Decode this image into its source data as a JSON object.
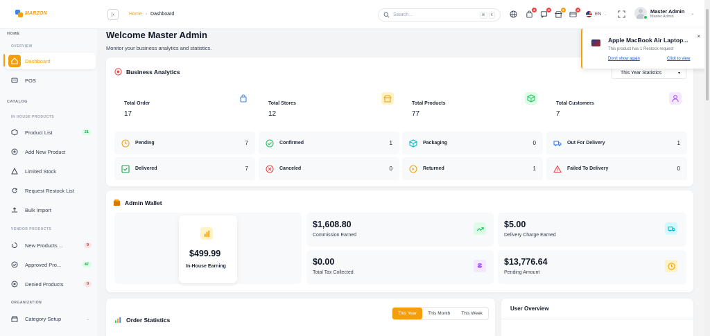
{
  "brand": {
    "name": "MARZON",
    "accent": "#f59e0b"
  },
  "header": {
    "collapse_icon": "collapse-sidebar-icon",
    "breadcrumb": {
      "home": "Home",
      "separator": "›",
      "current": "Dashboard"
    },
    "search": {
      "placeholder": "Search...",
      "shortcut_cmd": "⌘",
      "shortcut_key": "K"
    },
    "badges": {
      "orders": "4",
      "messages": "4",
      "stores": "0",
      "payments": "4",
      "wallet": "4"
    },
    "language": "EN",
    "user": {
      "name": "Master Admin",
      "role": "Master Admin"
    }
  },
  "sidebar": {
    "home_heading": "HOME",
    "overview_heading": "OVERVIEW",
    "overview_items": [
      {
        "label": "Dashboard",
        "icon": "dashboard-icon"
      },
      {
        "label": "POS",
        "icon": "pos-icon"
      }
    ],
    "catalog_heading": "CATALOG",
    "inhouse_heading": "IN HOUSE PRODUCTS",
    "inhouse_items": [
      {
        "label": "Product List",
        "badge": "21"
      },
      {
        "label": "Add New Product"
      },
      {
        "label": "Limited Stock"
      },
      {
        "label": "Request Restock List"
      },
      {
        "label": "Bulk Import"
      }
    ],
    "vendor_heading": "VENDOR PRODUCTS",
    "vendor_items": [
      {
        "label": "New Products ...",
        "badge": "9"
      },
      {
        "label": "Approved Pro...",
        "badge": "47"
      },
      {
        "label": "Denied Products",
        "badge": "0"
      }
    ],
    "org_heading": "ORGANIZATION",
    "org_items": [
      {
        "label": "Category Setup",
        "chevron": "⌄"
      }
    ]
  },
  "main": {
    "welcome_title": "Welcome Master Admin",
    "welcome_sub": "Monitor your business analytics and statistics."
  },
  "analytics": {
    "title": "Business Analytics",
    "filter": "This Year Statistics",
    "filter_chevron": "▾",
    "stats": [
      {
        "label": "Total Order",
        "value": "17",
        "icon": "shopping-bag-icon",
        "color": "#3b82f6"
      },
      {
        "label": "Total Stores",
        "value": "12",
        "icon": "store-icon",
        "color": "#f59e0b"
      },
      {
        "label": "Total Products",
        "value": "77",
        "icon": "box-icon",
        "color": "#22c55e"
      },
      {
        "label": "Total Customers",
        "value": "7",
        "icon": "user-icon",
        "color": "#a855f7"
      }
    ],
    "statuses": [
      {
        "label": "Pending",
        "value": "7",
        "icon": "clock-icon",
        "color": "#f59e0b"
      },
      {
        "label": "Confirmed",
        "value": "1",
        "icon": "check-circle-icon",
        "color": "#22c55e"
      },
      {
        "label": "Packaging",
        "value": "0",
        "icon": "package-icon",
        "color": "#06b6d4"
      },
      {
        "label": "Out For Delivery",
        "value": "1",
        "icon": "truck-icon",
        "color": "#3b82f6"
      },
      {
        "label": "Delivered",
        "value": "7",
        "icon": "check-square-icon",
        "color": "#16a34a"
      },
      {
        "label": "Canceled",
        "value": "0",
        "icon": "x-circle-icon",
        "color": "#ef4444"
      },
      {
        "label": "Returned",
        "value": "1",
        "icon": "return-icon",
        "color": "#f59e0b"
      },
      {
        "label": "Failed To Delivery",
        "value": "0",
        "icon": "warning-icon",
        "color": "#ef4444"
      }
    ]
  },
  "wallet": {
    "title": "Admin Wallet",
    "inhouse": {
      "amount": "$499.99",
      "label": "In-House Earning"
    },
    "items": [
      {
        "amount": "$1,608.80",
        "label": "Commission Earned",
        "icon": "trend-up-icon",
        "color": "#22c55e"
      },
      {
        "amount": "$5.00",
        "label": "Delivery Charge Earned",
        "icon": "truck-icon",
        "color": "#06b6d4"
      },
      {
        "amount": "$0.00",
        "label": "Total Tax Collected",
        "icon": "currency-icon",
        "color": "#a855f7"
      },
      {
        "amount": "$13,776.64",
        "label": "Pending Amount",
        "icon": "clock-icon",
        "color": "#f59e0b"
      }
    ]
  },
  "orders": {
    "title": "Order Statistics",
    "tabs": [
      "This Year",
      "This Month",
      "This Week"
    ]
  },
  "user_overview": {
    "title": "User Overview"
  },
  "toast": {
    "title": "Apple MacBook Air Laptop...",
    "text": "This product has 1 Restock request",
    "dismiss": "Don't show again",
    "view": "Click to view",
    "close": "×"
  }
}
